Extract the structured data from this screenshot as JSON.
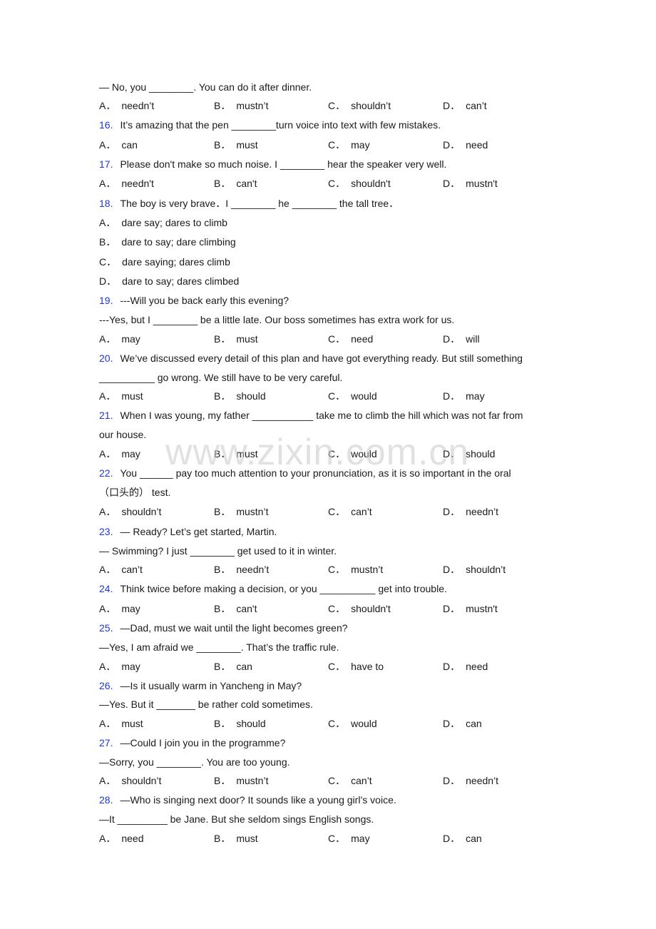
{
  "watermark": "www.zixin.com.cn",
  "lead": {
    "prompt": "— No, you ________. You can do it after dinner.",
    "options": {
      "A": "needn’t",
      "B": "mustn’t",
      "C": "shouldn’t",
      "D": "can’t"
    }
  },
  "questions": [
    {
      "number": "16.",
      "lines": [
        "It’s amazing that the pen ________turn voice into text with few mistakes."
      ],
      "options": {
        "A": "can",
        "B": "must",
        "C": "may",
        "D": "need"
      }
    },
    {
      "number": "17.",
      "lines": [
        "Please don't make so much noise. I ________ hear the speaker very well."
      ],
      "options": {
        "A": "needn't",
        "B": "can't",
        "C": "shouldn't",
        "D": "mustn't"
      }
    },
    {
      "number": "18.",
      "lines": [
        "The boy is very brave．I ________ he ________ the tall tree．"
      ],
      "options": {
        "A": "dare say; dares to climb",
        "B": "dare to say; dare climbing",
        "C": "dare saying; dares climb",
        "D": "dare to say; dares climbed"
      }
    },
    {
      "number": "19.",
      "lines": [
        "---Will you be back early this evening?",
        "---Yes, but I ________ be a little late. Our boss sometimes has extra work for us."
      ],
      "options": {
        "A": "may",
        "B": "must",
        "C": "need",
        "D": "will"
      }
    },
    {
      "number": "20.",
      "lines": [
        "We’ve discussed every detail of this plan and have got everything ready. But still something",
        "__________ go wrong. We still have to be very careful."
      ],
      "options": {
        "A": "must",
        "B": "should",
        "C": "would",
        "D": "may"
      }
    },
    {
      "number": "21.",
      "lines": [
        "When I was young, my father ___________ take me to climb the hill which was not far from",
        "our house."
      ],
      "options": {
        "A": "may",
        "B": "must",
        "C": "would",
        "D": "should"
      }
    },
    {
      "number": "22.",
      "lines": [
        "You ______ pay too much attention to your pronunciation, as it is so important in the oral",
        "（口头的） test."
      ],
      "options": {
        "A": "shouldn’t",
        "B": "mustn’t",
        "C": "can’t",
        "D": "needn’t"
      }
    },
    {
      "number": "23.",
      "lines": [
        "— Ready? Let’s get started, Martin.",
        "— Swimming? I just ________ get used to it in winter."
      ],
      "options": {
        "A": "can’t",
        "B": "needn’t",
        "C": "mustn’t",
        "D": "shouldn’t"
      }
    },
    {
      "number": "24.",
      "lines": [
        "Think twice before making a decision, or you __________ get into trouble."
      ],
      "options": {
        "A": "may",
        "B": "can't",
        "C": "shouldn't",
        "D": "mustn't"
      }
    },
    {
      "number": "25.",
      "lines": [
        "—Dad, must we wait until the light becomes green?",
        "—Yes, I am afraid we ________. That’s the traffic rule."
      ],
      "options": {
        "A": "may",
        "B": "can",
        "C": "have to",
        "D": "need"
      }
    },
    {
      "number": "26.",
      "lines": [
        "—Is it usually warm in Yancheng in May?",
        "—Yes. But it _______ be rather cold sometimes."
      ],
      "options": {
        "A": "must",
        "B": "should",
        "C": "would",
        "D": "can"
      }
    },
    {
      "number": "27.",
      "lines": [
        "—Could I join you in the programme?",
        "—Sorry, you ________. You are too young."
      ],
      "options": {
        "A": "shouldn’t",
        "B": "mustn’t",
        "C": "can’t",
        "D": "needn’t"
      }
    },
    {
      "number": "28.",
      "lines": [
        "—Who is singing next door? It sounds like a young girl’s voice.",
        "—It _________ be Jane. But she seldom sings English songs."
      ],
      "options": {
        "A": "need",
        "B": "must",
        "C": "may",
        "D": "can"
      }
    }
  ],
  "option_letters": {
    "A": "A．",
    "B": "B．",
    "C": "C．",
    "D": "D．"
  },
  "colors": {
    "question_number": "#1f35d8",
    "text": "#1a1a1a",
    "watermark": "#c8c8c8"
  }
}
